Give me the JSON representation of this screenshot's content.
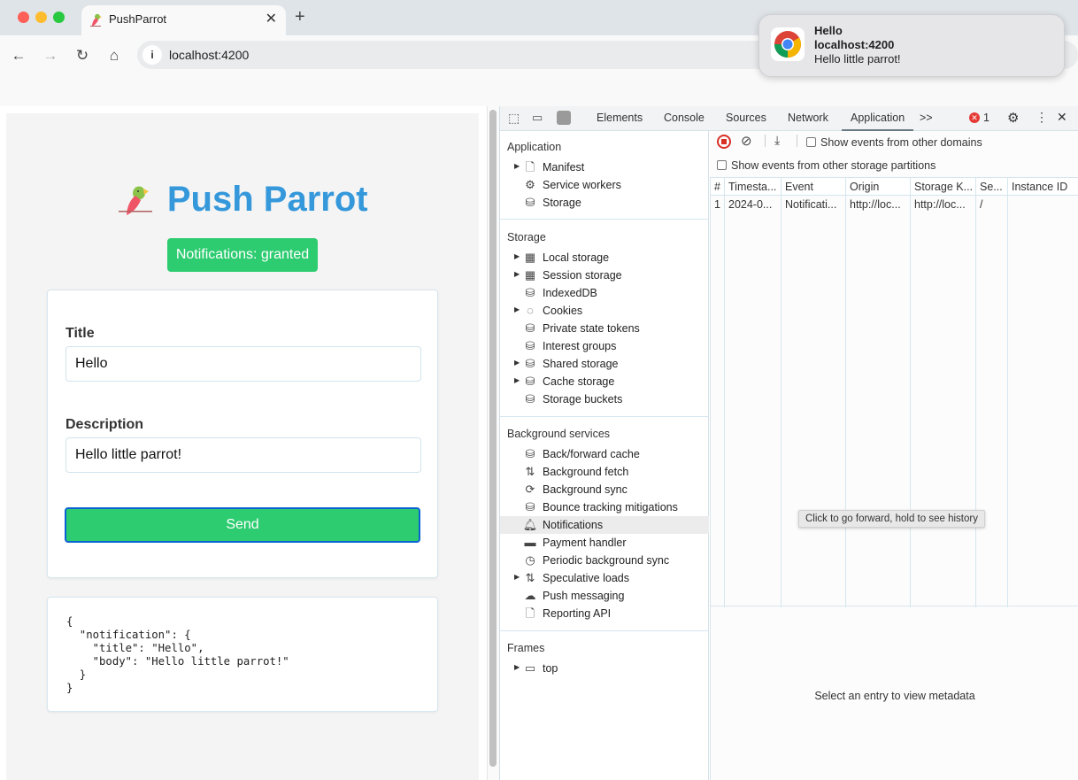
{
  "browser": {
    "tab_title": "PushParrot",
    "url": "localhost:4200",
    "new_tab_label": "+"
  },
  "notification_popup": {
    "title": "Hello",
    "origin": "localhost:4200",
    "body": "Hello little parrot!"
  },
  "app": {
    "title": "Push Parrot",
    "permission_badge": "Notifications: granted",
    "form": {
      "title_label": "Title",
      "title_value": "Hello",
      "description_label": "Description",
      "description_value": "Hello little parrot!",
      "send_label": "Send"
    },
    "payload_preview": "{\n  \"notification\": {\n    \"title\": \"Hello\",\n    \"body\": \"Hello little parrot!\"\n  }\n}"
  },
  "devtools": {
    "tabs": [
      "Elements",
      "Console",
      "Sources",
      "Network",
      "Application"
    ],
    "active_tab": "Application",
    "more_tabs": ">>",
    "error_count": "1",
    "sidebar": {
      "application_header": "Application",
      "application_items": [
        "Manifest",
        "Service workers",
        "Storage"
      ],
      "storage_header": "Storage",
      "storage_items": [
        "Local storage",
        "Session storage",
        "IndexedDB",
        "Cookies",
        "Private state tokens",
        "Interest groups",
        "Shared storage",
        "Cache storage",
        "Storage buckets"
      ],
      "background_header": "Background services",
      "background_items": [
        "Back/forward cache",
        "Background fetch",
        "Background sync",
        "Bounce tracking mitigations",
        "Notifications",
        "Payment handler",
        "Periodic background sync",
        "Speculative loads",
        "Push messaging",
        "Reporting API"
      ],
      "selected_item": "Notifications",
      "frames_header": "Frames",
      "frames_items": [
        "top"
      ]
    },
    "toolbar": {
      "show_other_domains": "Show events from other domains",
      "show_other_partitions": "Show events from other storage partitions"
    },
    "table": {
      "columns": [
        "#",
        "Timesta...",
        "Event",
        "Origin",
        "Storage K...",
        "Se...",
        "Instance ID"
      ],
      "rows": [
        [
          "1",
          "2024-0...",
          "Notificati...",
          "http://loc...",
          "http://loc...",
          "/",
          ""
        ]
      ]
    },
    "tooltip": "Click to go forward, hold to see history",
    "metadata_placeholder": "Select an entry to view metadata"
  }
}
